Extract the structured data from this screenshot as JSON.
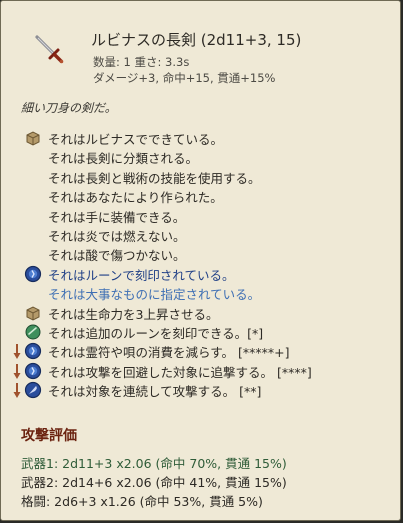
{
  "item": {
    "icon": "sword-icon",
    "title": "ルビナスの長剣 (2d11+3, 15)",
    "stats_line1": "数量: 1  重さ: 3.3s",
    "stats_line2": "ダメージ+3, 命中+15, 貫通+15%",
    "description": "細い刀身の剣だ。"
  },
  "properties": [
    {
      "text": "それはルビナスでできている。",
      "icon": "material-icon",
      "style": "normal",
      "arrow": false
    },
    {
      "text": "それは長剣に分類される。",
      "icon": "",
      "style": "normal",
      "arrow": false
    },
    {
      "text": "それは長剣と戦術の技能を使用する。",
      "icon": "",
      "style": "normal",
      "arrow": false
    },
    {
      "text": "それはあなたにより作られた。",
      "icon": "",
      "style": "normal",
      "arrow": false
    },
    {
      "text": "それは手に装備できる。",
      "icon": "",
      "style": "normal",
      "arrow": false
    },
    {
      "text": "それは炎では燃えない。",
      "icon": "",
      "style": "normal",
      "arrow": false
    },
    {
      "text": "それは酸で傷つかない。",
      "icon": "",
      "style": "normal",
      "arrow": false
    },
    {
      "text": "それはルーンで刻印されている。",
      "icon": "rune-icon",
      "style": "blue",
      "arrow": false
    },
    {
      "text": "それは大事なものに指定されている。",
      "icon": "",
      "style": "lblue",
      "arrow": false
    },
    {
      "text": "それは生命力を3上昇させる。",
      "icon": "material-icon",
      "style": "normal",
      "arrow": false
    },
    {
      "text": "それは追加のルーンを刻印できる。[*]",
      "icon": "green-orb-icon",
      "style": "normal",
      "arrow": false
    },
    {
      "text": "それは霊符や唄の消費を減らす。 [*****+]",
      "icon": "rune-icon",
      "style": "normal",
      "arrow": true
    },
    {
      "text": "それは攻撃を回避した対象に追撃する。 [****]",
      "icon": "rune-icon",
      "style": "normal",
      "arrow": true
    },
    {
      "text": "それは対象を連続して攻撃する。 [**]",
      "icon": "feather-rune-icon",
      "style": "normal",
      "arrow": true
    }
  ],
  "attack_eval": {
    "title": "攻撃評価",
    "rows": [
      "武器1: 2d11+3  x2.06  (命中 70%, 貫通 15%)",
      "武器2: 2d14+6  x2.06  (命中 41%, 貫通 15%)",
      "格闘: 2d6+3  x1.26  (命中 53%, 貫通 5%)"
    ]
  },
  "colors": {
    "background": "#efe9d6",
    "border": "#6f6a55",
    "text": "#2d2a25",
    "rune_blue": "#1f3f86",
    "light_blue": "#3e6fb4",
    "section_title": "#6b2310",
    "weapon1_green": "#2f5c38"
  }
}
